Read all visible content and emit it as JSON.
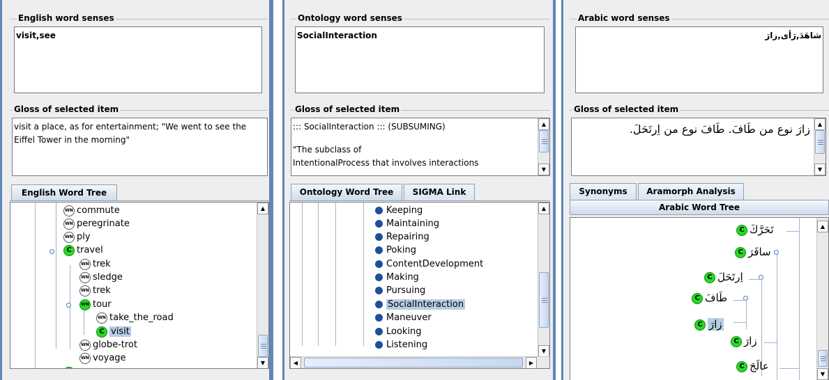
{
  "left": {
    "senses_title": "English word senses",
    "senses_value": "visit,see",
    "gloss_title": "Gloss of selected item",
    "gloss_value": "visit a place, as for entertainment; \"We went to see the Eiffel Tower in the morning\"",
    "tab_label": "English Word Tree",
    "tree": [
      {
        "label": "commute",
        "icon": "wn-icon"
      },
      {
        "label": "peregrinate",
        "icon": "wn-icon"
      },
      {
        "label": "ply",
        "icon": "wn-icon"
      },
      {
        "label": "travel",
        "icon": "concept-icon"
      },
      {
        "label": "trek",
        "icon": "wn-icon"
      },
      {
        "label": "sledge",
        "icon": "wn-icon"
      },
      {
        "label": "trek",
        "icon": "wn-icon"
      },
      {
        "label": "tour",
        "icon": "concept-wn-icon"
      },
      {
        "label": "take_the_road",
        "icon": "wn-icon"
      },
      {
        "label": "visit",
        "icon": "concept-icon",
        "selected": true
      },
      {
        "label": "globe-trot",
        "icon": "wn-icon"
      },
      {
        "label": "voyage",
        "icon": "wn-icon"
      }
    ]
  },
  "middle": {
    "senses_title": "Ontology word senses",
    "senses_value": "SocialInteraction",
    "gloss_title": "Gloss of selected item",
    "gloss_line1": "::: SocialInteraction ::: (SUBSUMING)",
    "gloss_line2": "\"The subclass of",
    "gloss_line3": "IntentionalProcess that involves interactions",
    "tab_ontology": "Ontology Word Tree",
    "tab_sigma": "SIGMA Link",
    "tree": [
      "Keeping",
      "Maintaining",
      "Repairing",
      "Poking",
      "ContentDevelopment",
      "Making",
      "Pursuing",
      "SocialInteraction",
      "Maneuver",
      "Looking",
      "Listening"
    ],
    "selected": "SocialInteraction"
  },
  "right": {
    "senses_title": "Arabic word senses",
    "senses_value": "شاهَدَ,رَأى,زارَ",
    "gloss_title": "Gloss of selected item",
    "gloss_value": "زارَ نوع من طَافَ. طَافَ نوع من اِرتَحَلَ.",
    "tab_synonyms": "Synonyms",
    "tab_aramorph": "Aramorph Analysis",
    "tree_header": "Arabic Word Tree",
    "tree": [
      {
        "label": "تَحَرَّكَ"
      },
      {
        "label": "سافَرَ"
      },
      {
        "label": "اِرتَحَلَ"
      },
      {
        "label": "طَافَ"
      },
      {
        "label": "زارَ",
        "selected": true
      },
      {
        "label": "زارَ"
      },
      {
        "label": "عالَجَ"
      }
    ]
  },
  "icons": {
    "wn_text": "WN",
    "concept_text": "C"
  }
}
